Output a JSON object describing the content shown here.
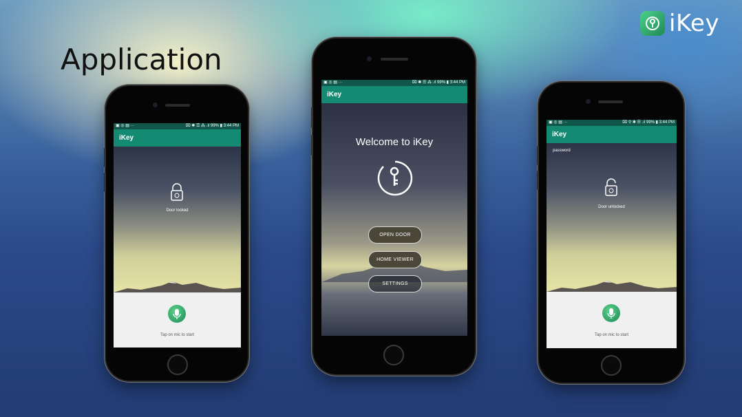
{
  "slide": {
    "heading": "Application"
  },
  "brand": {
    "name": "iKey",
    "icon": "key-lock-icon"
  },
  "phones": [
    {
      "status": {
        "left": "▣ ◎ ▤ ···",
        "right": "⌧ ✱ ☰ ⁂ .ıl 99% ▮ 3:44 PM"
      },
      "app_title": "iKey",
      "lock_state": "Door locked",
      "mic_hint": "Tap on mic to start"
    },
    {
      "status": {
        "left": "▣ ◎ ▤ ···",
        "right": "⌧ ✱ ☰ ⁂ .ıl 99% ▮ 3:44 PM"
      },
      "app_title": "iKey",
      "welcome": "Welcome to iKey",
      "buttons": {
        "open_door": "OPEN DOOR",
        "home_viewer": "HOME VIEWER",
        "settings": "SETTINGS"
      }
    },
    {
      "status": {
        "left": "▣ ◎ ▤ ···",
        "right": "⌧ ⚲ ✱ ☰ .ıl 99% ▮ 3:44 PM"
      },
      "app_title": "iKey",
      "field_label": "password",
      "lock_state": "Door unlocked",
      "mic_hint": "Tap on mic to start"
    }
  ],
  "colors": {
    "appbar": "#158a72",
    "statusbar": "#10564a",
    "mic": "#2fae6a"
  }
}
